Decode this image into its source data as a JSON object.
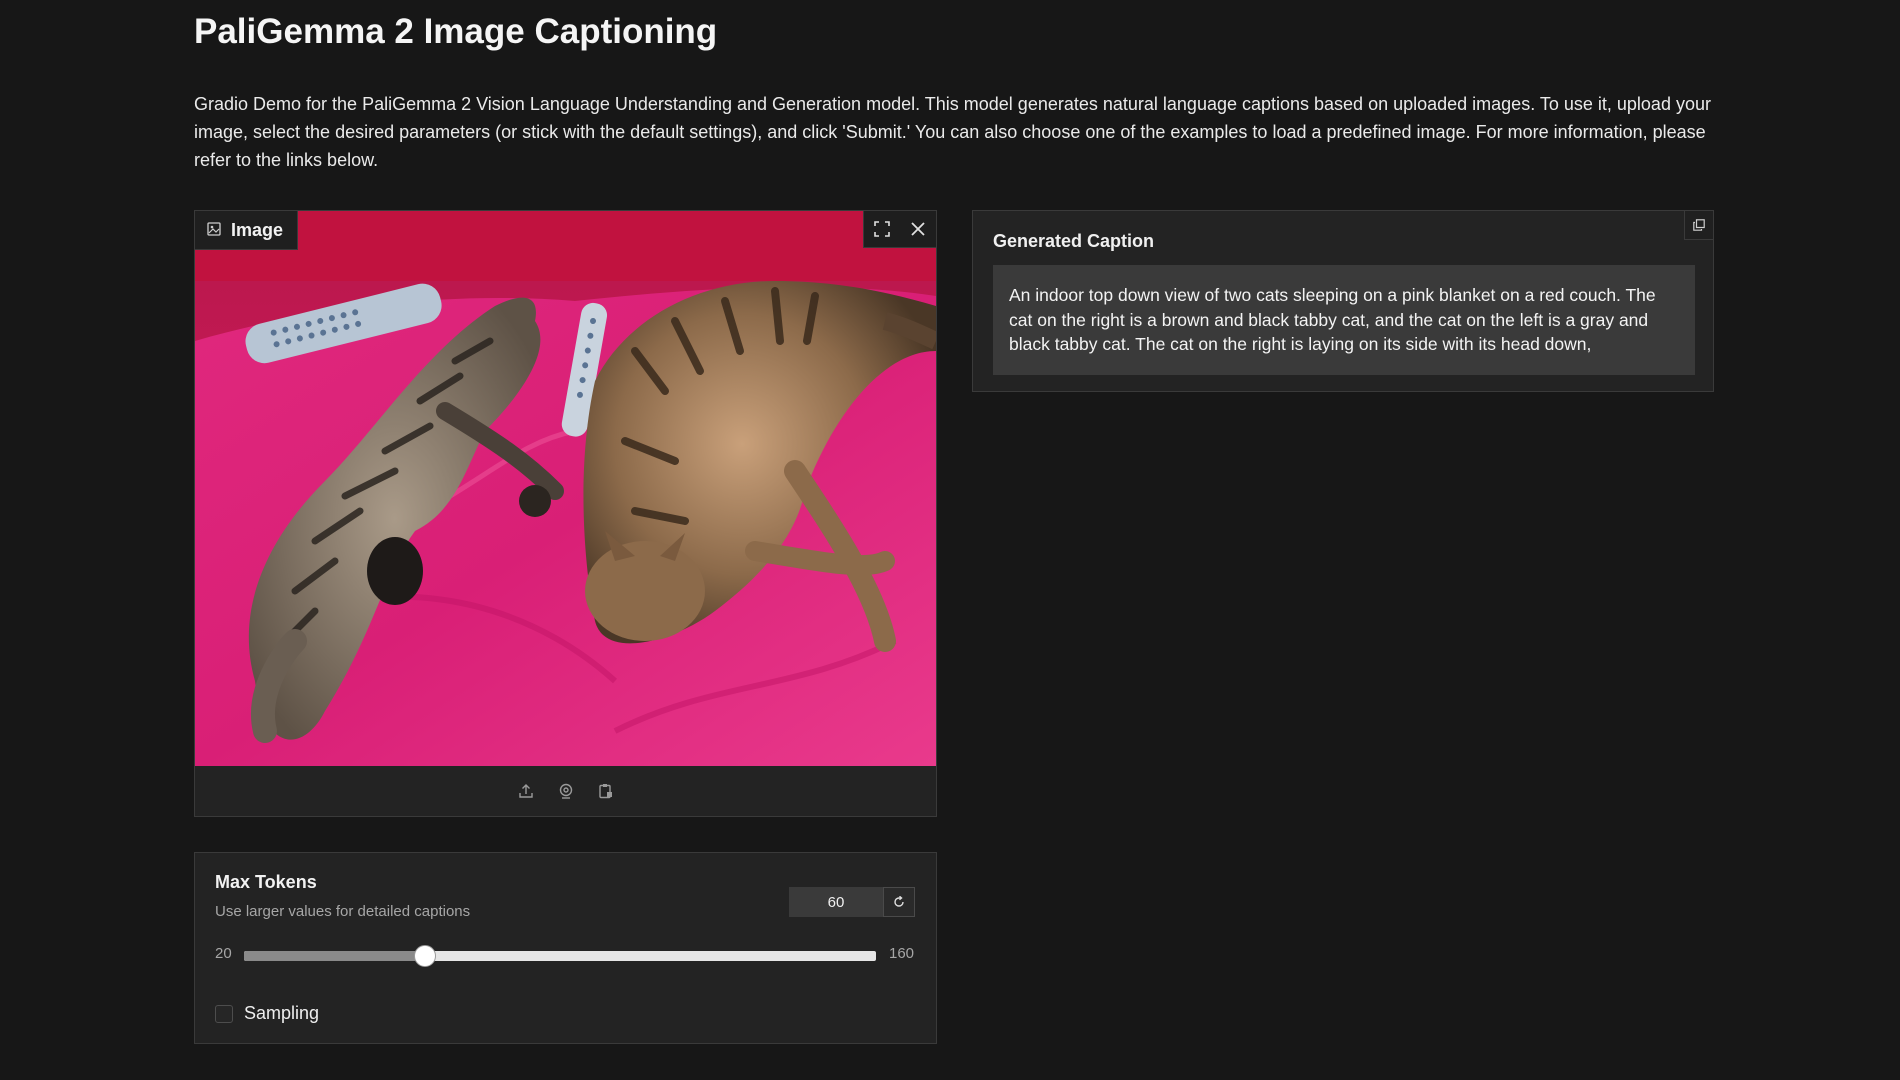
{
  "header": {
    "title": "PaliGemma 2 Image Captioning",
    "description": "Gradio Demo for the PaliGemma 2 Vision Language Understanding and Generation model. This model generates natural language captions based on uploaded images. To use it, upload your image, select the desired parameters (or stick with the default settings), and click 'Submit.' You can also choose one of the examples to load a predefined image. For more information, please refer to the links below."
  },
  "image_input": {
    "label": "Image",
    "label_icon": "image-icon",
    "tools": [
      "fullscreen-icon",
      "close-icon"
    ],
    "sources": [
      "upload-icon",
      "webcam-icon",
      "clipboard-icon"
    ]
  },
  "caption_output": {
    "label": "Generated Caption",
    "text": "An indoor top down view of two cats sleeping on a pink blanket on a red couch. The cat on the right is a brown and black tabby cat, and the cat on the left is a gray and black tabby cat. The cat on the right is laying on its side with its head down,",
    "copy_icon": "copy-icon"
  },
  "max_tokens": {
    "label": "Max Tokens",
    "info": "Use larger values for detailed captions",
    "value": "60",
    "min": "20",
    "max": "160",
    "reset_icon": "reset-icon"
  },
  "sampling": {
    "label": "Sampling",
    "checked": false
  },
  "colors": {
    "background": "#171717",
    "panel": "#232323",
    "caption_box": "#3a3a3a"
  }
}
